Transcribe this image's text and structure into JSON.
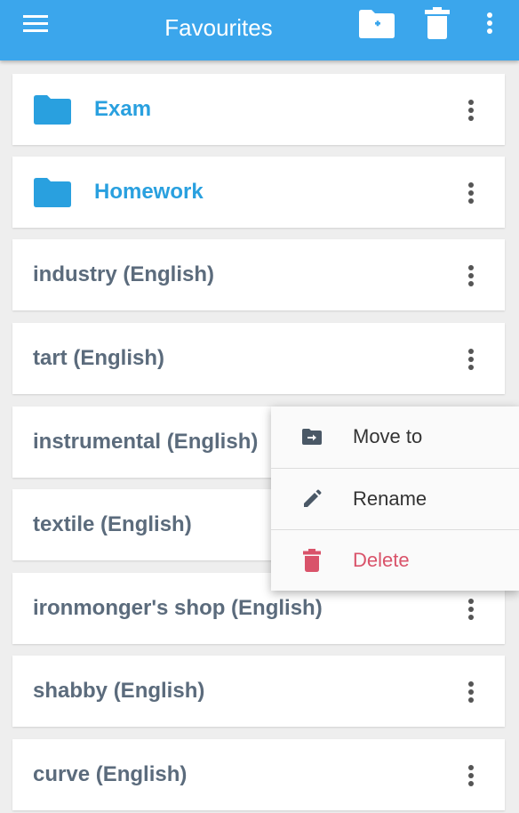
{
  "appbar": {
    "title": "Favourites",
    "icons": {
      "menu": "hamburger-icon",
      "new_folder": "folder-plus-icon",
      "delete": "trash-icon",
      "more": "more-vertical-icon"
    },
    "color": "#3ba6ec"
  },
  "list": {
    "folders": [
      {
        "label": "Exam"
      },
      {
        "label": "Homework"
      }
    ],
    "words": [
      {
        "label": "industry (English)"
      },
      {
        "label": "tart (English)"
      },
      {
        "label": "instrumental (English)"
      },
      {
        "label": "textile (English)"
      },
      {
        "label": "ironmonger's shop (English)"
      },
      {
        "label": "shabby (English)"
      },
      {
        "label": "curve (English)"
      }
    ],
    "folder_color": "#29a0df",
    "word_color": "#5b6b7c"
  },
  "context_menu": {
    "items": [
      {
        "label": "Move to",
        "icon": "move-to-folder-icon"
      },
      {
        "label": "Rename",
        "icon": "pencil-icon"
      },
      {
        "label": "Delete",
        "icon": "trash-icon",
        "color": "#d9536a"
      }
    ]
  }
}
